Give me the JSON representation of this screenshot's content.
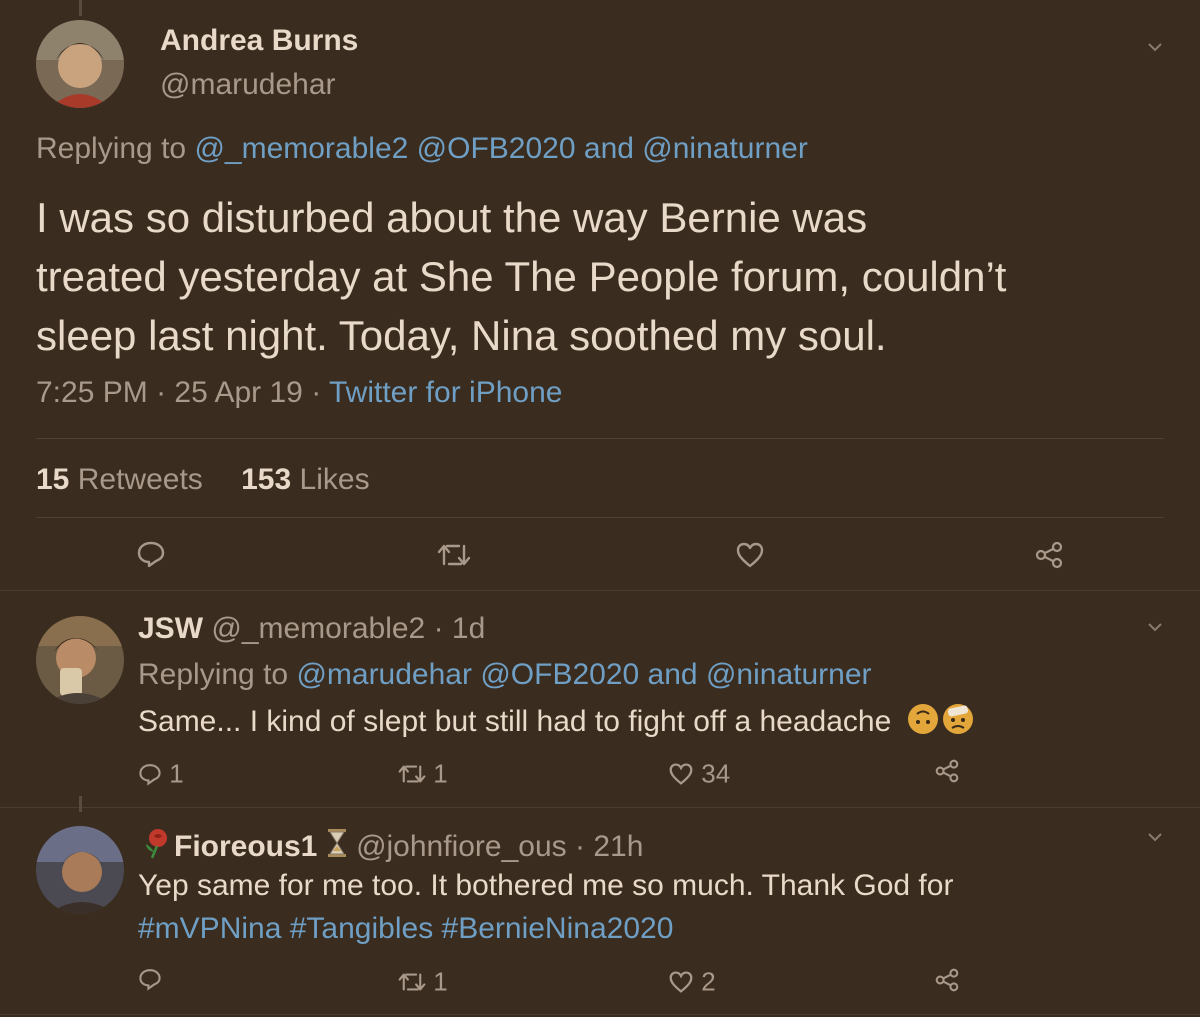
{
  "main_tweet": {
    "author_name": "Andrea Burns",
    "handle": "@marudehar",
    "replying_prefix": "Replying to",
    "replying_to": [
      "@_memorable2",
      "@OFB2020"
    ],
    "replying_and": "and",
    "replying_last": "@ninaturner",
    "text_line1": "I was so disturbed about the way Bernie was",
    "text_line2": "treated yesterday at She The People forum, couldn’t",
    "text_line3": "sleep last night. Today, Nina soothed my soul.",
    "time": "7:25 PM",
    "sep": "·",
    "date": "25 Apr 19",
    "source": "Twitter for iPhone",
    "retweets_count": "15",
    "retweets_label": "Retweets",
    "likes_count": "153",
    "likes_label": "Likes"
  },
  "reply1": {
    "author_name": "JSW",
    "handle": "@_memorable2",
    "age": "1d",
    "replying_prefix": "Replying to",
    "replying_to": [
      "@marudehar",
      "@OFB2020"
    ],
    "replying_and": "and",
    "replying_last": "@ninaturner",
    "text": "Same... I kind of slept but still had to fight off a headache",
    "reply_count": "1",
    "retweet_count": "1",
    "like_count": "34"
  },
  "reply2": {
    "author_name": "Fioreous1",
    "handle": "@johnfiore_ous",
    "age": "21h",
    "text": "Yep same for me too. It bothered me so much. Thank God for",
    "hashtags": [
      "#mVPNina",
      "#Tangibles",
      "#BernieNina2020"
    ],
    "retweet_count": "1",
    "like_count": "2"
  },
  "colors": {
    "background": "#3a2c1f",
    "text": "#e8d9c8",
    "muted": "#a8998a",
    "link": "#6f9fc4"
  }
}
